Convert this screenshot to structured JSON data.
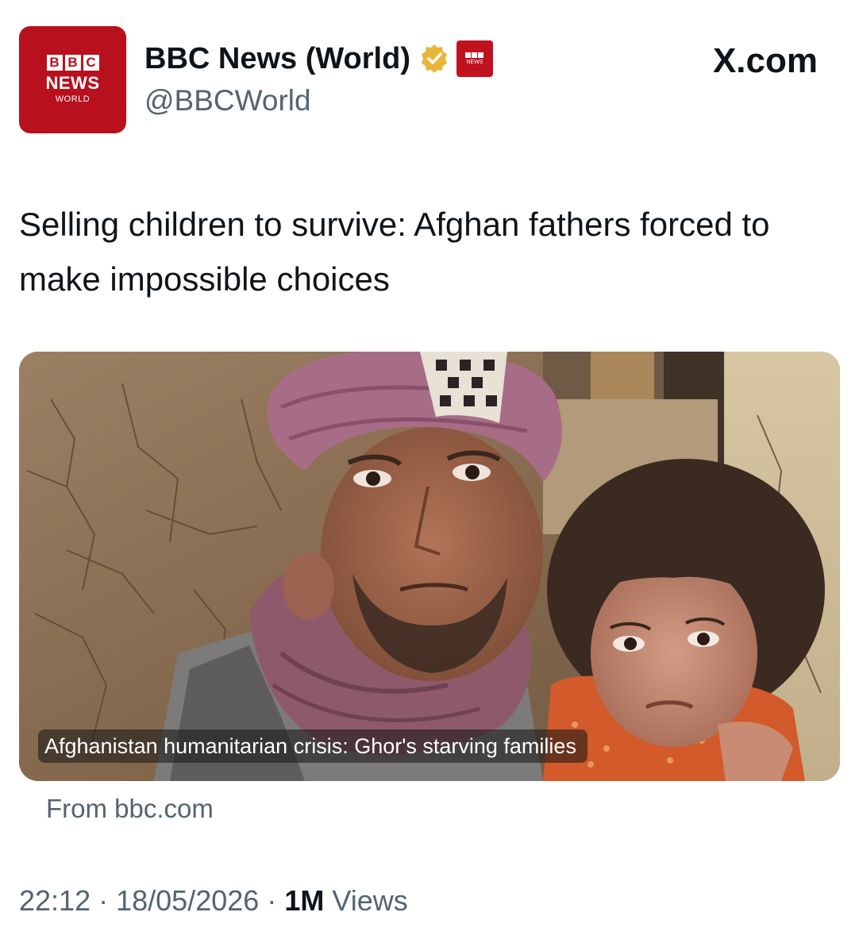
{
  "account": {
    "avatar": {
      "blocks": [
        "B",
        "B",
        "C"
      ],
      "line1": "NEWS",
      "line2": "WORLD"
    },
    "display_name": "BBC News (World)",
    "handle": "@BBCWorld",
    "verified_badge_color": "#e8b63a",
    "affiliate_badge_text": "NEWS"
  },
  "site_label": "X.com",
  "tweet": {
    "text": "Selling children to survive: Afghan fathers forced to make impossible choices"
  },
  "link_card": {
    "caption": "Afghanistan humanitarian crisis: Ghor's starving families",
    "source": "From bbc.com"
  },
  "meta": {
    "time": "22:12",
    "date": "18/05/2026",
    "views_count": "1M",
    "views_label": "Views"
  },
  "colors": {
    "brand_red": "#b8111d",
    "text_primary": "#0f1419",
    "text_secondary": "#536471"
  }
}
